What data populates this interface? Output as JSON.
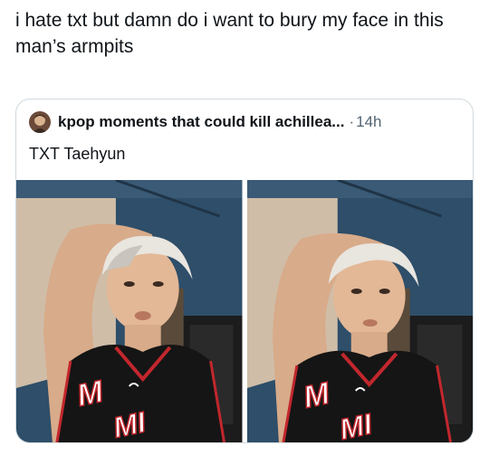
{
  "post": {
    "text": "i hate txt but damn do i want to bury my face in this man’s armpits"
  },
  "quote": {
    "author_name": "kpop moments that could kill achillea...",
    "separator": "·",
    "time": "14h",
    "body": "TXT Taehyun"
  },
  "media": {
    "jersey_text_left": "M",
    "jersey_text_left_2": "MI",
    "jersey_text_right": "M",
    "jersey_text_right_2": "MI"
  },
  "colors": {
    "text_primary": "#0f1419",
    "text_secondary": "#536471",
    "card_border": "#cfd9de",
    "wall_blue": "#2b4b66",
    "jersey_black": "#151515",
    "jersey_red": "#c1272d"
  },
  "icons": {
    "avatar": "profile-avatar"
  }
}
